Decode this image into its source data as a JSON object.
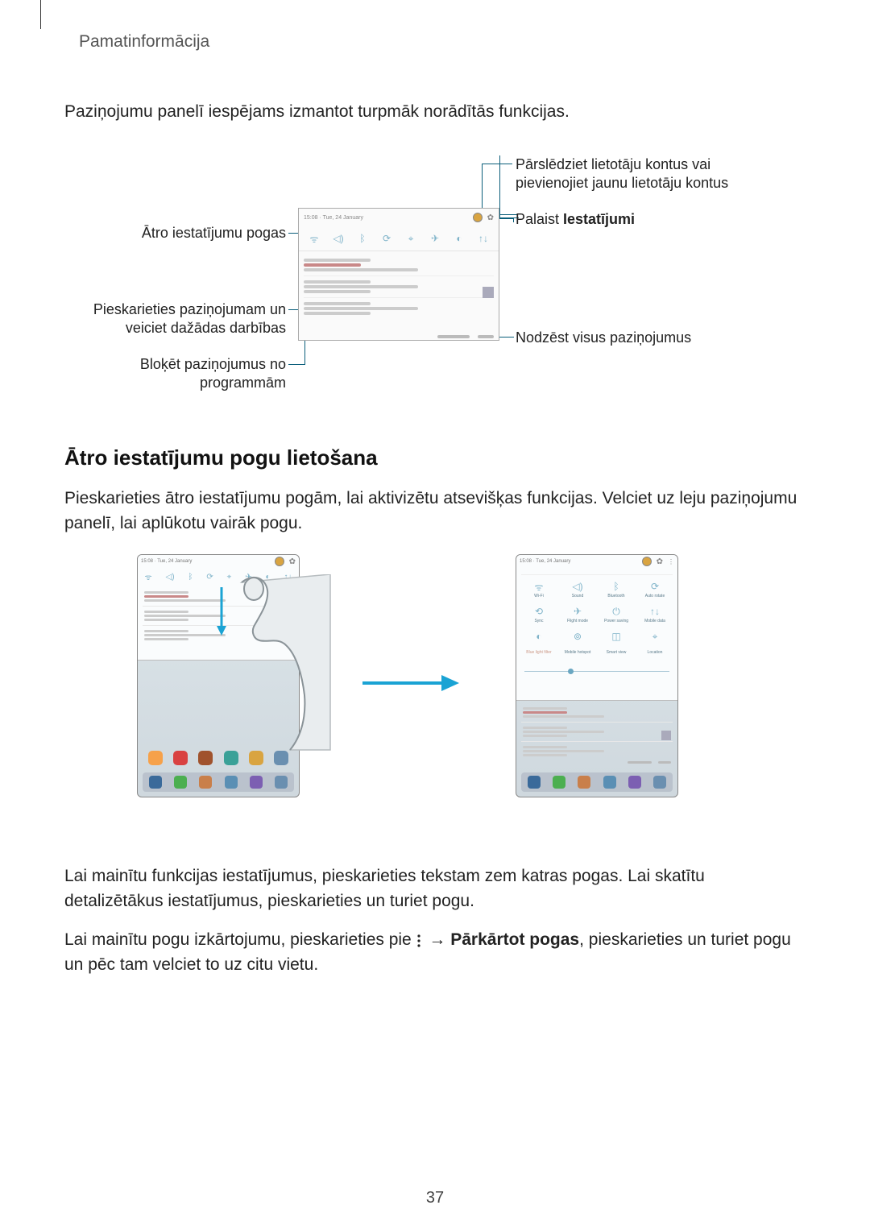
{
  "header": {
    "section_title": "Pamatinformācija"
  },
  "intro": "Paziņojumu panelī iespējams izmantot turpmāk norādītās funkcijas.",
  "callouts": {
    "left1": "Ātro iestatījumu pogas",
    "left2": "Pieskarieties paziņojumam un veiciet dažādas darbības",
    "left3": "Bloķēt paziņojumus no programmām",
    "right1": "Pārslēdziet lietotāju kontus vai pievienojiet jaunu lietotāju kontus",
    "right2_pre": "Palaist ",
    "right2_bold": "Iestatījumi",
    "right3": "Nodzēst visus paziņojumus"
  },
  "subheading": "Ātro iestatījumu pogu lietošana",
  "para1": "Pieskarieties ātro iestatījumu pogām, lai aktivizētu atsevišķas funkcijas. Velciet uz leju paziņojumu panelī, lai aplūkotu vairāk pogu.",
  "para2": "Lai mainītu funkcijas iestatījumus, pieskarieties tekstam zem katras pogas. Lai skatītu detalizētākus iestatījumus, pieskarieties un turiet pogu.",
  "para3_pre": "Lai mainītu pogu izkārtojumu, pieskarieties pie ",
  "para3_arrow": " → ",
  "para3_bold": "Pārkārtot pogas",
  "para3_post": ", pieskarieties un turiet pogu un pēc tam velciet to uz citu vietu.",
  "page_number": "37"
}
